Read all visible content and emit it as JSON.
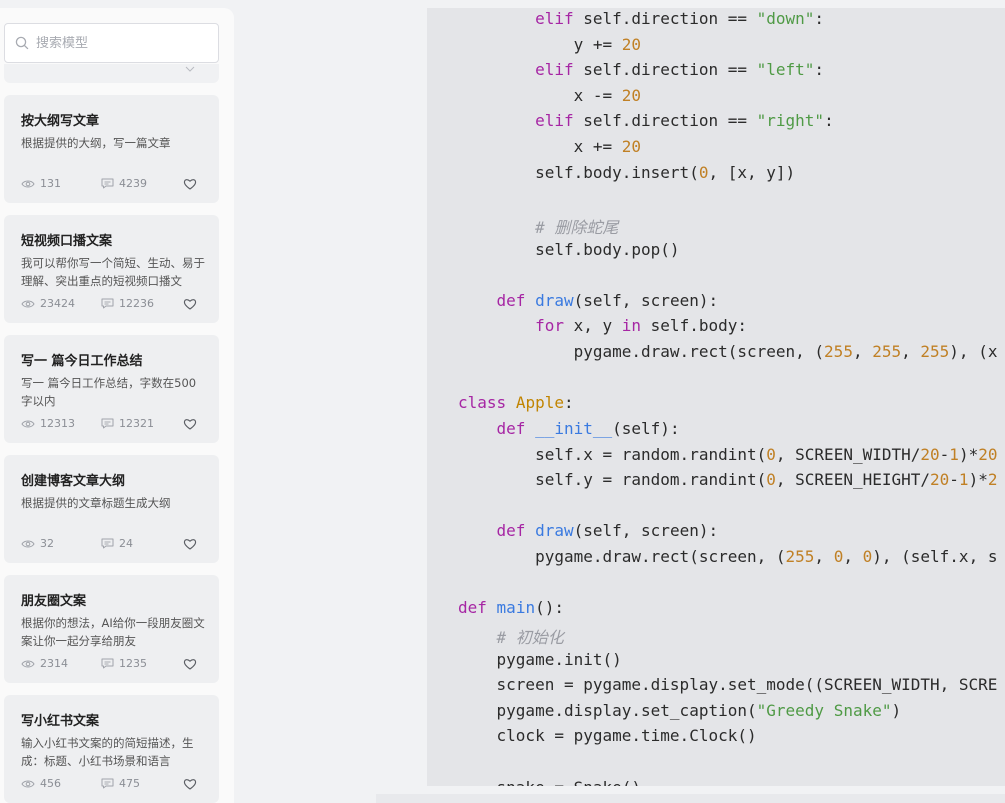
{
  "search": {
    "placeholder": "搜索模型"
  },
  "cards": [
    {
      "title": "按大纲写文章",
      "desc": "根据提供的大纲，写一篇文章",
      "views": "131",
      "comments": "4239"
    },
    {
      "title": "短视频口播文案",
      "desc": "我可以帮你写一个简短、生动、易于理解、突出重点的短视频口播文",
      "views": "23424",
      "comments": "12236"
    },
    {
      "title": "写一 篇今日工作总结",
      "desc": "写一 篇今日工作总结，字数在500字以内",
      "views": "12313",
      "comments": "12321"
    },
    {
      "title": "创建博客文章大纲",
      "desc": "根据提供的文章标题生成大纲",
      "views": "32",
      "comments": "24"
    },
    {
      "title": "朋友圈文案",
      "desc": "根据你的想法，AI给你一段朋友圈文案让你一起分享给朋友",
      "views": "2314",
      "comments": "1235"
    },
    {
      "title": "写小红书文案",
      "desc": "输入小红书文案的的简短描述，生成：标题、小红书场景和语言",
      "views": "456",
      "comments": "475"
    }
  ],
  "code": {
    "lines": [
      [
        [
          "        ",
          ""
        ],
        [
          "elif",
          "kw"
        ],
        [
          " self.direction == ",
          ""
        ],
        [
          "\"down\"",
          "str"
        ],
        [
          ":",
          ""
        ]
      ],
      [
        [
          "            y += ",
          ""
        ],
        [
          "20",
          "num"
        ]
      ],
      [
        [
          "        ",
          ""
        ],
        [
          "elif",
          "kw"
        ],
        [
          " self.direction == ",
          ""
        ],
        [
          "\"left\"",
          "str"
        ],
        [
          ":",
          ""
        ]
      ],
      [
        [
          "            x -= ",
          ""
        ],
        [
          "20",
          "num"
        ]
      ],
      [
        [
          "        ",
          ""
        ],
        [
          "elif",
          "kw"
        ],
        [
          " self.direction == ",
          ""
        ],
        [
          "\"right\"",
          "str"
        ],
        [
          ":",
          ""
        ]
      ],
      [
        [
          "            x += ",
          ""
        ],
        [
          "20",
          "num"
        ]
      ],
      [
        [
          "        self.body.insert(",
          ""
        ],
        [
          "0",
          "num"
        ],
        [
          ", [x, y])",
          ""
        ]
      ],
      [
        [
          "",
          ""
        ]
      ],
      [
        [
          "        ",
          ""
        ],
        [
          "# 删除蛇尾",
          "cmt"
        ]
      ],
      [
        [
          "        self.body.pop()",
          ""
        ]
      ],
      [
        [
          "",
          ""
        ]
      ],
      [
        [
          "    ",
          ""
        ],
        [
          "def",
          "kw"
        ],
        [
          " ",
          ""
        ],
        [
          "draw",
          "fn"
        ],
        [
          "(self, screen):",
          ""
        ]
      ],
      [
        [
          "        ",
          ""
        ],
        [
          "for",
          "kw"
        ],
        [
          " x, y ",
          ""
        ],
        [
          "in",
          "kw"
        ],
        [
          " self.body:",
          ""
        ]
      ],
      [
        [
          "            pygame.draw.rect(screen, (",
          ""
        ],
        [
          "255",
          "num"
        ],
        [
          ", ",
          ""
        ],
        [
          "255",
          "num"
        ],
        [
          ", ",
          ""
        ],
        [
          "255",
          "num"
        ],
        [
          "), (x",
          ""
        ]
      ],
      [
        [
          "",
          ""
        ]
      ],
      [
        [
          "",
          ""
        ],
        [
          "class",
          "kw"
        ],
        [
          " ",
          ""
        ],
        [
          "Apple",
          "cls"
        ],
        [
          ":",
          ""
        ]
      ],
      [
        [
          "    ",
          ""
        ],
        [
          "def",
          "kw"
        ],
        [
          " ",
          ""
        ],
        [
          "__init__",
          "fn"
        ],
        [
          "(self):",
          ""
        ]
      ],
      [
        [
          "        self.x = random.randint(",
          ""
        ],
        [
          "0",
          "num"
        ],
        [
          ", SCREEN_WIDTH/",
          ""
        ],
        [
          "20",
          "num"
        ],
        [
          "-",
          ""
        ],
        [
          "1",
          "num"
        ],
        [
          ")*",
          ""
        ],
        [
          "20",
          "num"
        ]
      ],
      [
        [
          "        self.y = random.randint(",
          ""
        ],
        [
          "0",
          "num"
        ],
        [
          ", SCREEN_HEIGHT/",
          ""
        ],
        [
          "20",
          "num"
        ],
        [
          "-",
          ""
        ],
        [
          "1",
          "num"
        ],
        [
          ")*",
          ""
        ],
        [
          "2",
          "num"
        ]
      ],
      [
        [
          "",
          ""
        ]
      ],
      [
        [
          "    ",
          ""
        ],
        [
          "def",
          "kw"
        ],
        [
          " ",
          ""
        ],
        [
          "draw",
          "fn"
        ],
        [
          "(self, screen):",
          ""
        ]
      ],
      [
        [
          "        pygame.draw.rect(screen, (",
          ""
        ],
        [
          "255",
          "num"
        ],
        [
          ", ",
          ""
        ],
        [
          "0",
          "num"
        ],
        [
          ", ",
          ""
        ],
        [
          "0",
          "num"
        ],
        [
          "), (self.x, s",
          ""
        ]
      ],
      [
        [
          "",
          ""
        ]
      ],
      [
        [
          "",
          ""
        ],
        [
          "def",
          "kw"
        ],
        [
          " ",
          ""
        ],
        [
          "main",
          "fn"
        ],
        [
          "():",
          ""
        ]
      ],
      [
        [
          "    ",
          ""
        ],
        [
          "# 初始化",
          "cmt"
        ]
      ],
      [
        [
          "    pygame.init()",
          ""
        ]
      ],
      [
        [
          "    screen = pygame.display.set_mode((SCREEN_WIDTH, SCRE",
          ""
        ]
      ],
      [
        [
          "    pygame.display.set_caption(",
          ""
        ],
        [
          "\"Greedy Snake\"",
          "str"
        ],
        [
          ")",
          ""
        ]
      ],
      [
        [
          "    clock = pygame.time.Clock()",
          ""
        ]
      ],
      [
        [
          "",
          ""
        ]
      ],
      [
        [
          "    snake = Snake()",
          ""
        ]
      ]
    ]
  }
}
